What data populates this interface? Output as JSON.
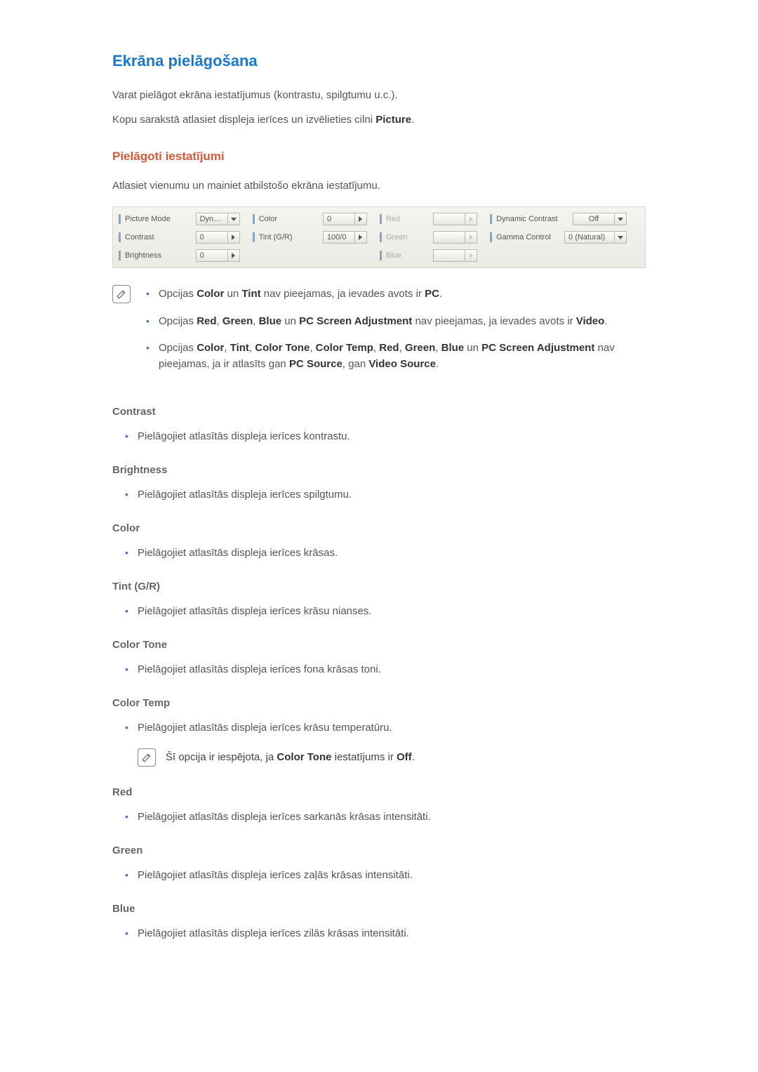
{
  "headings": {
    "main": "Ekrāna pielāgošana",
    "sub": "Pielāgoti iestatījumi"
  },
  "intro": {
    "p1": "Varat pielāgot ekrāna iestatījumus (kontrastu, spilgtumu u.c.).",
    "p2_pre": "Kopu sarakstā atlasiet displeja ierīces un izvēlieties cilni ",
    "p2_bold": "Picture",
    "p2_post": "."
  },
  "sub_intro": "Atlasiet vienumu un mainiet atbilstošo ekrāna iestatījumu.",
  "panel": {
    "row1": {
      "picture_mode_label": "Picture Mode",
      "picture_mode_value": "Dyn…",
      "color_label": "Color",
      "color_value": "0",
      "red_label": "Red",
      "red_value": "",
      "dyn_contrast_label": "Dynamic Contrast",
      "dyn_contrast_value": "Off"
    },
    "row2": {
      "contrast_label": "Contrast",
      "contrast_value": "0",
      "tint_label": "Tint (G/R)",
      "tint_value": "100/0",
      "green_label": "Green",
      "green_value": "",
      "gamma_label": "Gamma Control",
      "gamma_value": "0 (Natural)"
    },
    "row3": {
      "brightness_label": "Brightness",
      "brightness_value": "0",
      "blue_label": "Blue",
      "blue_value": ""
    }
  },
  "notes": {
    "icon_name": "note-pencil-icon",
    "items": [
      {
        "parts": [
          {
            "t": "Opcijas "
          },
          {
            "b": "Color"
          },
          {
            "t": " un "
          },
          {
            "b": "Tint"
          },
          {
            "t": " nav pieejamas, ja ievades avots ir "
          },
          {
            "b": "PC"
          },
          {
            "t": "."
          }
        ]
      },
      {
        "parts": [
          {
            "t": "Opcijas "
          },
          {
            "b": "Red"
          },
          {
            "t": ", "
          },
          {
            "b": "Green"
          },
          {
            "t": ", "
          },
          {
            "b": "Blue"
          },
          {
            "t": " un "
          },
          {
            "b": "PC Screen Adjustment"
          },
          {
            "t": " nav pieejamas, ja ievades avots ir "
          },
          {
            "b": "Video"
          },
          {
            "t": "."
          }
        ]
      },
      {
        "parts": [
          {
            "t": "Opcijas "
          },
          {
            "b": "Color"
          },
          {
            "t": ", "
          },
          {
            "b": "Tint"
          },
          {
            "t": ", "
          },
          {
            "b": "Color Tone"
          },
          {
            "t": ", "
          },
          {
            "b": "Color Temp"
          },
          {
            "t": ", "
          },
          {
            "b": "Red"
          },
          {
            "t": ", "
          },
          {
            "b": "Green"
          },
          {
            "t": ", "
          },
          {
            "b": "Blue"
          },
          {
            "t": " un "
          },
          {
            "b": "PC Screen Adjustment"
          },
          {
            "t": " nav pieejamas, ja ir atlasīts gan "
          },
          {
            "b": "PC Source"
          },
          {
            "t": ", gan "
          },
          {
            "b": "Video Source"
          },
          {
            "t": "."
          }
        ]
      }
    ]
  },
  "settings": [
    {
      "title": "Contrast",
      "desc": "Pielāgojiet atlasītās displeja ierīces kontrastu."
    },
    {
      "title": "Brightness",
      "desc": "Pielāgojiet atlasītās displeja ierīces spilgtumu."
    },
    {
      "title": "Color",
      "desc": "Pielāgojiet atlasītās displeja ierīces krāsas."
    },
    {
      "title": "Tint (G/R)",
      "desc": "Pielāgojiet atlasītās displeja ierīces krāsu nianses."
    },
    {
      "title": "Color Tone",
      "desc": "Pielāgojiet atlasītās displeja ierīces fona krāsas toni."
    },
    {
      "title": "Color Temp",
      "desc": "Pielāgojiet atlasītās displeja ierīces krāsu temperatūru.",
      "inline_note": {
        "parts": [
          {
            "t": "Šī opcija ir iespējota, ja "
          },
          {
            "b": "Color Tone"
          },
          {
            "t": " iestatījums ir "
          },
          {
            "b": "Off"
          },
          {
            "t": "."
          }
        ]
      }
    },
    {
      "title": "Red",
      "desc": "Pielāgojiet atlasītās displeja ierīces sarkanās krāsas intensitāti."
    },
    {
      "title": "Green",
      "desc": "Pielāgojiet atlasītās displeja ierīces zaļās krāsas intensitāti."
    },
    {
      "title": "Blue",
      "desc": "Pielāgojiet atlasītās displeja ierīces zilās krāsas intensitāti."
    }
  ]
}
